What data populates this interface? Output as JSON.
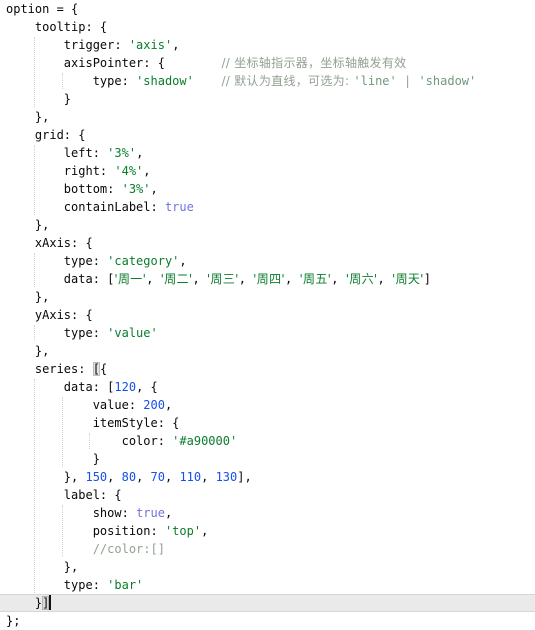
{
  "app": {
    "kind": "code-editor",
    "language": "javascript",
    "theme": "light",
    "colors": {
      "background": "#ffffff",
      "foreground": "#080808",
      "string": "#0a7d2c",
      "number": "#1750eb",
      "keyword": "#7272e0",
      "comment": "#93a193",
      "comment_string": "#6f9a7a",
      "current_line": "#eaeaea",
      "indent_guide": "#c9c9c9",
      "bracket_match": "#dadada",
      "caret": "#111111"
    },
    "caret_line": 34,
    "indent_size": 4
  },
  "code": {
    "lines": [
      {
        "n": 1,
        "indent": 0,
        "tokens": [
          {
            "t": "option = {",
            "c": "plain"
          }
        ]
      },
      {
        "n": 2,
        "indent": 1,
        "tokens": [
          {
            "t": "tooltip: {",
            "c": "plain"
          }
        ]
      },
      {
        "n": 3,
        "indent": 2,
        "tokens": [
          {
            "t": "trigger: ",
            "c": "plain"
          },
          {
            "t": "'axis'",
            "c": "str"
          },
          {
            "t": ",",
            "c": "plain"
          }
        ]
      },
      {
        "n": 4,
        "indent": 2,
        "tokens": [
          {
            "t": "axisPointer: {",
            "c": "plain"
          }
        ],
        "comment": {
          "col": 31,
          "parts": [
            {
              "t": "// 坐标轴指示器，坐标轴触发有效",
              "c": "cmt"
            }
          ]
        }
      },
      {
        "n": 5,
        "indent": 3,
        "tokens": [
          {
            "t": "type: ",
            "c": "plain"
          },
          {
            "t": "'shadow'",
            "c": "str"
          }
        ],
        "comment": {
          "col": 31,
          "parts": [
            {
              "t": "// 默认为直线，可选为: ",
              "c": "cmt"
            },
            {
              "t": "'line'",
              "c": "cmtstr"
            },
            {
              "t": " | ",
              "c": "cmt"
            },
            {
              "t": "'shadow'",
              "c": "cmtstr"
            }
          ]
        }
      },
      {
        "n": 6,
        "indent": 2,
        "tokens": [
          {
            "t": "}",
            "c": "plain"
          }
        ]
      },
      {
        "n": 7,
        "indent": 1,
        "tokens": [
          {
            "t": "},",
            "c": "plain"
          }
        ]
      },
      {
        "n": 8,
        "indent": 1,
        "tokens": [
          {
            "t": "grid: {",
            "c": "plain"
          }
        ]
      },
      {
        "n": 9,
        "indent": 2,
        "tokens": [
          {
            "t": "left: ",
            "c": "plain"
          },
          {
            "t": "'3%'",
            "c": "str"
          },
          {
            "t": ",",
            "c": "plain"
          }
        ]
      },
      {
        "n": 10,
        "indent": 2,
        "tokens": [
          {
            "t": "right: ",
            "c": "plain"
          },
          {
            "t": "'4%'",
            "c": "str"
          },
          {
            "t": ",",
            "c": "plain"
          }
        ]
      },
      {
        "n": 11,
        "indent": 2,
        "tokens": [
          {
            "t": "bottom: ",
            "c": "plain"
          },
          {
            "t": "'3%'",
            "c": "str"
          },
          {
            "t": ",",
            "c": "plain"
          }
        ]
      },
      {
        "n": 12,
        "indent": 2,
        "tokens": [
          {
            "t": "containLabel: ",
            "c": "plain"
          },
          {
            "t": "true",
            "c": "kw"
          }
        ]
      },
      {
        "n": 13,
        "indent": 1,
        "tokens": [
          {
            "t": "},",
            "c": "plain"
          }
        ]
      },
      {
        "n": 14,
        "indent": 1,
        "tokens": [
          {
            "t": "xAxis: {",
            "c": "plain"
          }
        ]
      },
      {
        "n": 15,
        "indent": 2,
        "tokens": [
          {
            "t": "type: ",
            "c": "plain"
          },
          {
            "t": "'category'",
            "c": "str"
          },
          {
            "t": ",",
            "c": "plain"
          }
        ]
      },
      {
        "n": 16,
        "indent": 2,
        "tokens": [
          {
            "t": "data: [",
            "c": "plain"
          },
          {
            "t": "'周一'",
            "c": "str"
          },
          {
            "t": ", ",
            "c": "plain"
          },
          {
            "t": "'周二'",
            "c": "str"
          },
          {
            "t": ", ",
            "c": "plain"
          },
          {
            "t": "'周三'",
            "c": "str"
          },
          {
            "t": ", ",
            "c": "plain"
          },
          {
            "t": "'周四'",
            "c": "str"
          },
          {
            "t": ", ",
            "c": "plain"
          },
          {
            "t": "'周五'",
            "c": "str"
          },
          {
            "t": ", ",
            "c": "plain"
          },
          {
            "t": "'周六'",
            "c": "str"
          },
          {
            "t": ", ",
            "c": "plain"
          },
          {
            "t": "'周天'",
            "c": "str"
          },
          {
            "t": "]",
            "c": "plain"
          }
        ]
      },
      {
        "n": 17,
        "indent": 1,
        "tokens": [
          {
            "t": "},",
            "c": "plain"
          }
        ]
      },
      {
        "n": 18,
        "indent": 1,
        "tokens": [
          {
            "t": "yAxis: {",
            "c": "plain"
          }
        ]
      },
      {
        "n": 19,
        "indent": 2,
        "tokens": [
          {
            "t": "type: ",
            "c": "plain"
          },
          {
            "t": "'value'",
            "c": "str"
          }
        ]
      },
      {
        "n": 20,
        "indent": 1,
        "tokens": [
          {
            "t": "},",
            "c": "plain"
          }
        ]
      },
      {
        "n": 21,
        "indent": 1,
        "tokens": [
          {
            "t": "series: ",
            "c": "plain"
          },
          {
            "t": "[",
            "c": "brmatch-open"
          },
          {
            "t": "{",
            "c": "plain"
          }
        ]
      },
      {
        "n": 22,
        "indent": 2,
        "tokens": [
          {
            "t": "data: [",
            "c": "plain"
          },
          {
            "t": "120",
            "c": "num"
          },
          {
            "t": ", {",
            "c": "plain"
          }
        ]
      },
      {
        "n": 23,
        "indent": 3,
        "tokens": [
          {
            "t": "value: ",
            "c": "plain"
          },
          {
            "t": "200",
            "c": "num"
          },
          {
            "t": ",",
            "c": "plain"
          }
        ]
      },
      {
        "n": 24,
        "indent": 3,
        "tokens": [
          {
            "t": "itemStyle: {",
            "c": "plain"
          }
        ]
      },
      {
        "n": 25,
        "indent": 4,
        "tokens": [
          {
            "t": "color: ",
            "c": "plain"
          },
          {
            "t": "'#a90000'",
            "c": "str"
          }
        ]
      },
      {
        "n": 26,
        "indent": 3,
        "tokens": [
          {
            "t": "}",
            "c": "plain"
          }
        ]
      },
      {
        "n": 27,
        "indent": 2,
        "tokens": [
          {
            "t": "}, ",
            "c": "plain"
          },
          {
            "t": "150",
            "c": "num"
          },
          {
            "t": ", ",
            "c": "plain"
          },
          {
            "t": "80",
            "c": "num"
          },
          {
            "t": ", ",
            "c": "plain"
          },
          {
            "t": "70",
            "c": "num"
          },
          {
            "t": ", ",
            "c": "plain"
          },
          {
            "t": "110",
            "c": "num"
          },
          {
            "t": ", ",
            "c": "plain"
          },
          {
            "t": "130",
            "c": "num"
          },
          {
            "t": "],",
            "c": "plain"
          }
        ]
      },
      {
        "n": 28,
        "indent": 2,
        "tokens": [
          {
            "t": "label: {",
            "c": "plain"
          }
        ]
      },
      {
        "n": 29,
        "indent": 3,
        "tokens": [
          {
            "t": "show: ",
            "c": "plain"
          },
          {
            "t": "true",
            "c": "kw"
          },
          {
            "t": ",",
            "c": "plain"
          }
        ]
      },
      {
        "n": 30,
        "indent": 3,
        "tokens": [
          {
            "t": "position: ",
            "c": "plain"
          },
          {
            "t": "'top'",
            "c": "str"
          },
          {
            "t": ",",
            "c": "plain"
          }
        ]
      },
      {
        "n": 31,
        "indent": 3,
        "tokens": [
          {
            "t": "//color:[]",
            "c": "cmt"
          }
        ]
      },
      {
        "n": 32,
        "indent": 2,
        "tokens": [
          {
            "t": "},",
            "c": "plain"
          }
        ]
      },
      {
        "n": 33,
        "indent": 2,
        "tokens": [
          {
            "t": "type: ",
            "c": "plain"
          },
          {
            "t": "'bar'",
            "c": "str"
          }
        ]
      },
      {
        "n": 34,
        "indent": 1,
        "current": true,
        "caret": true,
        "tokens": [
          {
            "t": "}",
            "c": "plain"
          },
          {
            "t": "]",
            "c": "brmatch"
          }
        ]
      },
      {
        "n": 35,
        "indent": 0,
        "tokens": [
          {
            "t": "};",
            "c": "plain"
          }
        ]
      }
    ],
    "indent_guides": [
      {
        "level": 2,
        "from_line": 3,
        "to_line": 6
      },
      {
        "level": 2,
        "from_line": 9,
        "to_line": 12
      },
      {
        "level": 2,
        "from_line": 15,
        "to_line": 16
      },
      {
        "level": 2,
        "from_line": 19,
        "to_line": 19
      },
      {
        "level": 2,
        "from_line": 22,
        "to_line": 33
      },
      {
        "level": 3,
        "from_line": 5,
        "to_line": 5
      },
      {
        "level": 3,
        "from_line": 23,
        "to_line": 26
      },
      {
        "level": 3,
        "from_line": 29,
        "to_line": 31
      },
      {
        "level": 4,
        "from_line": 25,
        "to_line": 25
      }
    ]
  }
}
